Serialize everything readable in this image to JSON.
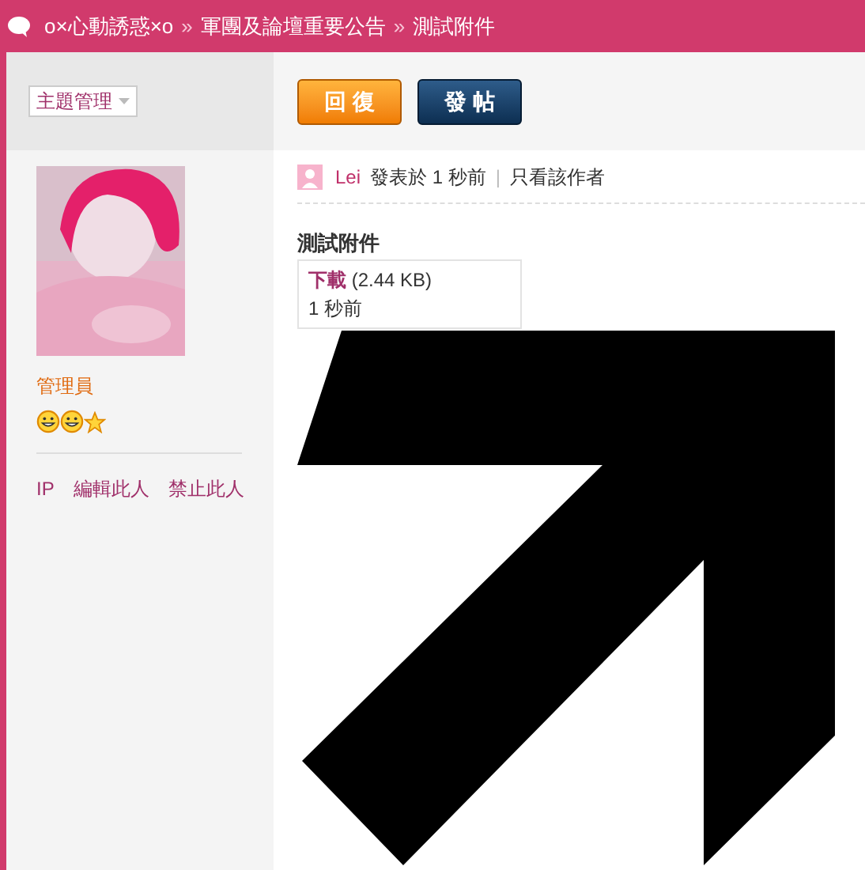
{
  "breadcrumb": {
    "items": [
      "o×心動誘惑×o",
      "軍團及論壇重要公告",
      "測試附件"
    ],
    "separator": "»"
  },
  "thread_tools": {
    "manage_label": "主題管理"
  },
  "buttons": [
    {
      "label": "回 復",
      "kind": "reply"
    },
    {
      "label": "發 帖",
      "kind": "post"
    }
  ],
  "author": {
    "role": "管理員",
    "badges": [
      {
        "kind": "smiley"
      },
      {
        "kind": "smiley"
      },
      {
        "kind": "star"
      }
    ],
    "actions": [
      "IP",
      "編輯此人",
      "禁止此人"
    ]
  },
  "post": {
    "author_name": "Lei",
    "posted": "發表於 1 秒前",
    "divider": "|",
    "filter_link": "只看該作者",
    "title": "測試附件"
  },
  "attachment": {
    "download": "下載",
    "size": "(2.44 KB)",
    "time": "1 秒前"
  }
}
